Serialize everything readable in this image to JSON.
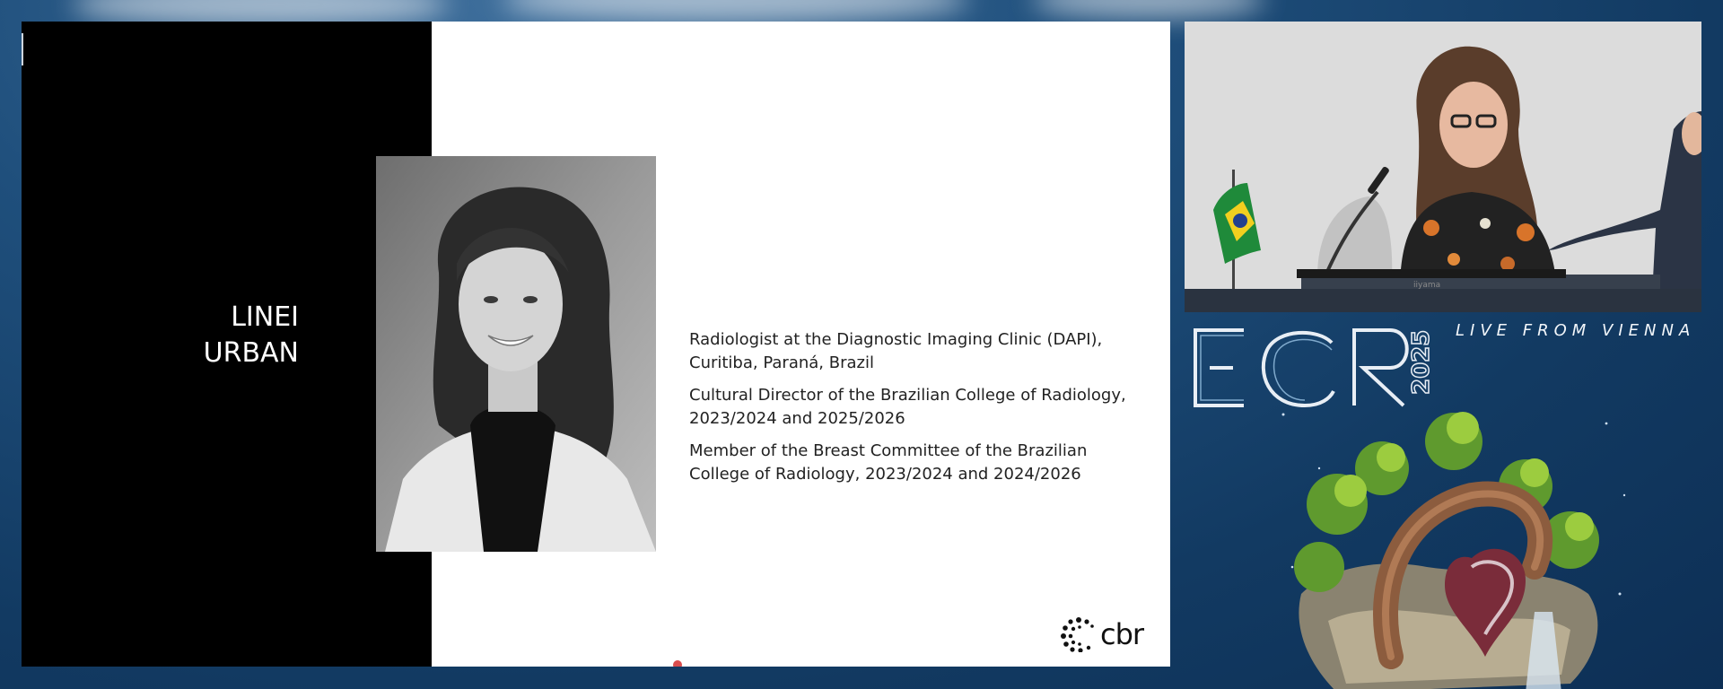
{
  "slide": {
    "speaker_name": [
      "LINEI",
      "URBAN"
    ],
    "bio": [
      "Radiologist at the Diagnostic Imaging Clinic (DAPI), Curitiba, Paraná, Brazil",
      "Cultural Director of the Brazilian College of Radiology, 2023/2024 and 2025/2026",
      "Member of the Breast Committee of the Brazilian College of Radiology, 2023/2024 and 2024/2026"
    ],
    "logo_text": "cbr"
  },
  "branding": {
    "ecr": "ECR",
    "year": "2025",
    "tagline": "LIVE FROM VIENNA"
  },
  "video": {
    "flag": "brazil-flag-icon",
    "podium_label": "iiyama"
  },
  "colors": {
    "background": "#1f4f7c",
    "slide_black": "#000000",
    "slide_white": "#ffffff"
  }
}
